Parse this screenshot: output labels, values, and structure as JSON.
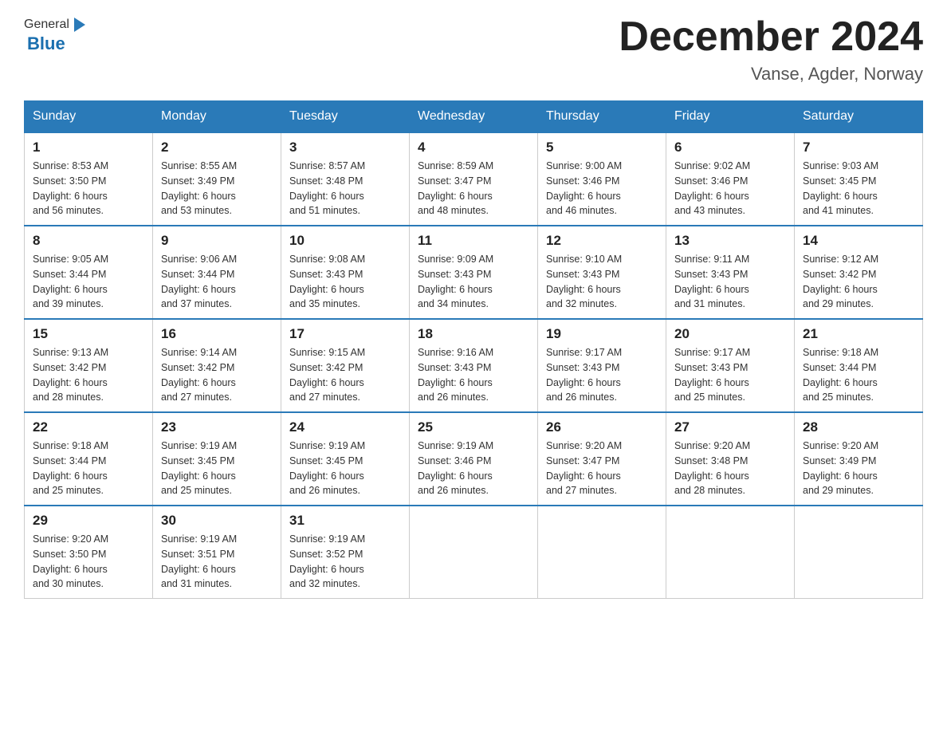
{
  "header": {
    "logo": {
      "general": "General",
      "blue": "Blue"
    },
    "title": "December 2024",
    "location": "Vanse, Agder, Norway"
  },
  "days_of_week": [
    "Sunday",
    "Monday",
    "Tuesday",
    "Wednesday",
    "Thursday",
    "Friday",
    "Saturday"
  ],
  "weeks": [
    [
      {
        "day": "1",
        "sunrise": "Sunrise: 8:53 AM",
        "sunset": "Sunset: 3:50 PM",
        "daylight": "Daylight: 6 hours",
        "daylight2": "and 56 minutes."
      },
      {
        "day": "2",
        "sunrise": "Sunrise: 8:55 AM",
        "sunset": "Sunset: 3:49 PM",
        "daylight": "Daylight: 6 hours",
        "daylight2": "and 53 minutes."
      },
      {
        "day": "3",
        "sunrise": "Sunrise: 8:57 AM",
        "sunset": "Sunset: 3:48 PM",
        "daylight": "Daylight: 6 hours",
        "daylight2": "and 51 minutes."
      },
      {
        "day": "4",
        "sunrise": "Sunrise: 8:59 AM",
        "sunset": "Sunset: 3:47 PM",
        "daylight": "Daylight: 6 hours",
        "daylight2": "and 48 minutes."
      },
      {
        "day": "5",
        "sunrise": "Sunrise: 9:00 AM",
        "sunset": "Sunset: 3:46 PM",
        "daylight": "Daylight: 6 hours",
        "daylight2": "and 46 minutes."
      },
      {
        "day": "6",
        "sunrise": "Sunrise: 9:02 AM",
        "sunset": "Sunset: 3:46 PM",
        "daylight": "Daylight: 6 hours",
        "daylight2": "and 43 minutes."
      },
      {
        "day": "7",
        "sunrise": "Sunrise: 9:03 AM",
        "sunset": "Sunset: 3:45 PM",
        "daylight": "Daylight: 6 hours",
        "daylight2": "and 41 minutes."
      }
    ],
    [
      {
        "day": "8",
        "sunrise": "Sunrise: 9:05 AM",
        "sunset": "Sunset: 3:44 PM",
        "daylight": "Daylight: 6 hours",
        "daylight2": "and 39 minutes."
      },
      {
        "day": "9",
        "sunrise": "Sunrise: 9:06 AM",
        "sunset": "Sunset: 3:44 PM",
        "daylight": "Daylight: 6 hours",
        "daylight2": "and 37 minutes."
      },
      {
        "day": "10",
        "sunrise": "Sunrise: 9:08 AM",
        "sunset": "Sunset: 3:43 PM",
        "daylight": "Daylight: 6 hours",
        "daylight2": "and 35 minutes."
      },
      {
        "day": "11",
        "sunrise": "Sunrise: 9:09 AM",
        "sunset": "Sunset: 3:43 PM",
        "daylight": "Daylight: 6 hours",
        "daylight2": "and 34 minutes."
      },
      {
        "day": "12",
        "sunrise": "Sunrise: 9:10 AM",
        "sunset": "Sunset: 3:43 PM",
        "daylight": "Daylight: 6 hours",
        "daylight2": "and 32 minutes."
      },
      {
        "day": "13",
        "sunrise": "Sunrise: 9:11 AM",
        "sunset": "Sunset: 3:43 PM",
        "daylight": "Daylight: 6 hours",
        "daylight2": "and 31 minutes."
      },
      {
        "day": "14",
        "sunrise": "Sunrise: 9:12 AM",
        "sunset": "Sunset: 3:42 PM",
        "daylight": "Daylight: 6 hours",
        "daylight2": "and 29 minutes."
      }
    ],
    [
      {
        "day": "15",
        "sunrise": "Sunrise: 9:13 AM",
        "sunset": "Sunset: 3:42 PM",
        "daylight": "Daylight: 6 hours",
        "daylight2": "and 28 minutes."
      },
      {
        "day": "16",
        "sunrise": "Sunrise: 9:14 AM",
        "sunset": "Sunset: 3:42 PM",
        "daylight": "Daylight: 6 hours",
        "daylight2": "and 27 minutes."
      },
      {
        "day": "17",
        "sunrise": "Sunrise: 9:15 AM",
        "sunset": "Sunset: 3:42 PM",
        "daylight": "Daylight: 6 hours",
        "daylight2": "and 27 minutes."
      },
      {
        "day": "18",
        "sunrise": "Sunrise: 9:16 AM",
        "sunset": "Sunset: 3:43 PM",
        "daylight": "Daylight: 6 hours",
        "daylight2": "and 26 minutes."
      },
      {
        "day": "19",
        "sunrise": "Sunrise: 9:17 AM",
        "sunset": "Sunset: 3:43 PM",
        "daylight": "Daylight: 6 hours",
        "daylight2": "and 26 minutes."
      },
      {
        "day": "20",
        "sunrise": "Sunrise: 9:17 AM",
        "sunset": "Sunset: 3:43 PM",
        "daylight": "Daylight: 6 hours",
        "daylight2": "and 25 minutes."
      },
      {
        "day": "21",
        "sunrise": "Sunrise: 9:18 AM",
        "sunset": "Sunset: 3:44 PM",
        "daylight": "Daylight: 6 hours",
        "daylight2": "and 25 minutes."
      }
    ],
    [
      {
        "day": "22",
        "sunrise": "Sunrise: 9:18 AM",
        "sunset": "Sunset: 3:44 PM",
        "daylight": "Daylight: 6 hours",
        "daylight2": "and 25 minutes."
      },
      {
        "day": "23",
        "sunrise": "Sunrise: 9:19 AM",
        "sunset": "Sunset: 3:45 PM",
        "daylight": "Daylight: 6 hours",
        "daylight2": "and 25 minutes."
      },
      {
        "day": "24",
        "sunrise": "Sunrise: 9:19 AM",
        "sunset": "Sunset: 3:45 PM",
        "daylight": "Daylight: 6 hours",
        "daylight2": "and 26 minutes."
      },
      {
        "day": "25",
        "sunrise": "Sunrise: 9:19 AM",
        "sunset": "Sunset: 3:46 PM",
        "daylight": "Daylight: 6 hours",
        "daylight2": "and 26 minutes."
      },
      {
        "day": "26",
        "sunrise": "Sunrise: 9:20 AM",
        "sunset": "Sunset: 3:47 PM",
        "daylight": "Daylight: 6 hours",
        "daylight2": "and 27 minutes."
      },
      {
        "day": "27",
        "sunrise": "Sunrise: 9:20 AM",
        "sunset": "Sunset: 3:48 PM",
        "daylight": "Daylight: 6 hours",
        "daylight2": "and 28 minutes."
      },
      {
        "day": "28",
        "sunrise": "Sunrise: 9:20 AM",
        "sunset": "Sunset: 3:49 PM",
        "daylight": "Daylight: 6 hours",
        "daylight2": "and 29 minutes."
      }
    ],
    [
      {
        "day": "29",
        "sunrise": "Sunrise: 9:20 AM",
        "sunset": "Sunset: 3:50 PM",
        "daylight": "Daylight: 6 hours",
        "daylight2": "and 30 minutes."
      },
      {
        "day": "30",
        "sunrise": "Sunrise: 9:19 AM",
        "sunset": "Sunset: 3:51 PM",
        "daylight": "Daylight: 6 hours",
        "daylight2": "and 31 minutes."
      },
      {
        "day": "31",
        "sunrise": "Sunrise: 9:19 AM",
        "sunset": "Sunset: 3:52 PM",
        "daylight": "Daylight: 6 hours",
        "daylight2": "and 32 minutes."
      },
      null,
      null,
      null,
      null
    ]
  ]
}
